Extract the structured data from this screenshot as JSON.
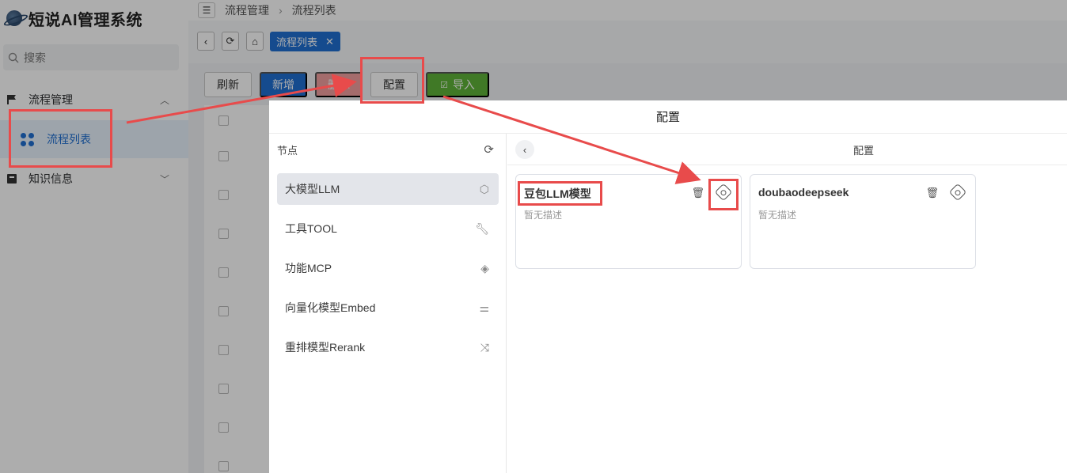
{
  "app": {
    "title": "短说AI管理系统"
  },
  "search": {
    "placeholder": "搜索"
  },
  "sidebar": {
    "groups": [
      {
        "label": "流程管理",
        "expanded": true
      },
      {
        "label": "知识信息",
        "expanded": false
      }
    ],
    "active_item": "流程列表"
  },
  "breadcrumb": [
    "流程管理",
    "流程列表"
  ],
  "tabs": [
    {
      "label": "流程列表",
      "active": true
    }
  ],
  "toolbar": {
    "refresh": "刷新",
    "add": "新增",
    "delete": "删除",
    "config": "配置",
    "import": "导入"
  },
  "dialog": {
    "title": "配置",
    "left": {
      "header": "节点",
      "nodes": [
        {
          "label": "大模型LLM",
          "icon": "cube-icon",
          "active": true
        },
        {
          "label": "工具TOOL",
          "icon": "wrench-icon",
          "active": false
        },
        {
          "label": "功能MCP",
          "icon": "layers-icon",
          "active": false
        },
        {
          "label": "向量化模型Embed",
          "icon": "sliders-icon",
          "active": false
        },
        {
          "label": "重排模型Rerank",
          "icon": "shuffle-icon",
          "active": false
        }
      ]
    },
    "right": {
      "header": "配置",
      "cards": [
        {
          "name": "豆包LLM模型",
          "desc": "暂无描述"
        },
        {
          "name": "doubaodeepseek",
          "desc": "暂无描述"
        }
      ]
    }
  },
  "colors": {
    "primary": "#1f6fd1",
    "danger": "#f2a0a0",
    "success": "#5fb339",
    "annotation": "#e84b4b"
  }
}
